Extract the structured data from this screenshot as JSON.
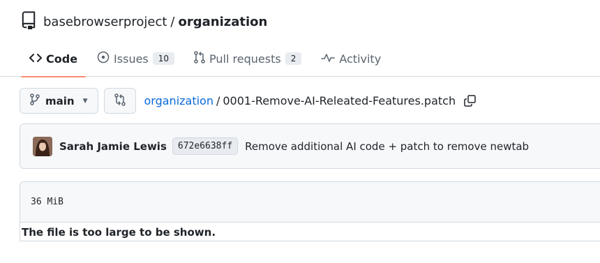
{
  "repo": {
    "owner": "basebrowserproject",
    "separator": "/",
    "name": "organization"
  },
  "tabs": [
    {
      "label": "Code",
      "icon": "code-icon",
      "selected": true
    },
    {
      "label": "Issues",
      "icon": "issue-opened-icon",
      "counter": "10"
    },
    {
      "label": "Pull requests",
      "icon": "git-pull-request-icon",
      "counter": "2"
    },
    {
      "label": "Activity",
      "icon": "pulse-icon"
    }
  ],
  "path_bar": {
    "branch": "main",
    "breadcrumb_repo": "organization",
    "breadcrumb_sep": "/",
    "file_name": "0001-Remove-AI-Releated-Features.patch"
  },
  "commit": {
    "author": "Sarah Jamie Lewis",
    "sha": "672e6638ff",
    "message": "Remove additional AI code + patch to remove newtab"
  },
  "file": {
    "size": "36 MiB",
    "message": "The file is too large to be shown."
  },
  "colors": {
    "link": "#0969da",
    "tab_underline": "#fd8c73",
    "border": "#d1d9e0",
    "muted_bg": "#f6f8fa"
  }
}
